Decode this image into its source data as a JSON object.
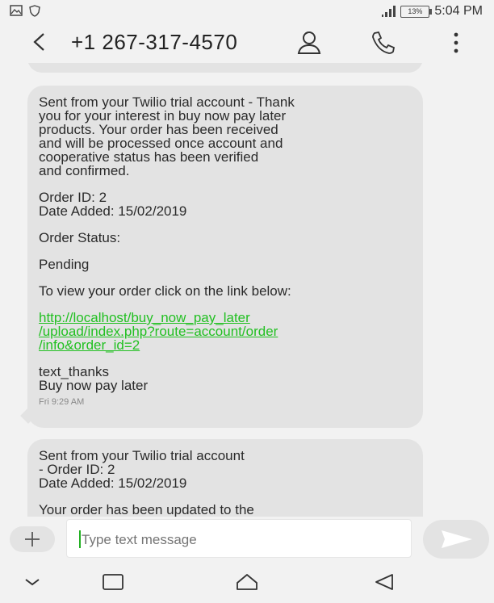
{
  "status_bar": {
    "time": "5:04 PM",
    "battery": "13%"
  },
  "header": {
    "contact": "+1 267-317-4570"
  },
  "messages": [
    {
      "paragraphs": [
        "Sent from your Twilio trial account - Thank\nyou for your interest in buy now pay later\nproducts. Your order has been received\nand will be processed once account and\ncooperative status has been verified\nand confirmed.",
        "Order ID: 2\nDate Added: 15/02/2019",
        "Order Status:",
        "Pending",
        "To view your order click on the link below:"
      ],
      "link": "http://localhost/buy_now_pay_later\n/upload/index.php?route=account/order\n/info&order_id=2",
      "footer": "text_thanks\nBuy now pay later",
      "time": "Fri 9:29 AM"
    },
    {
      "paragraphs": [
        "Sent from your Twilio trial account\n- Order ID: 2\nDate Added: 15/02/2019",
        "Your order has been updated to the"
      ]
    }
  ],
  "composer": {
    "placeholder": "Type text message"
  },
  "colors": {
    "link": "#22c022",
    "bubble": "#e3e3e3",
    "background": "#f2f2f2"
  }
}
